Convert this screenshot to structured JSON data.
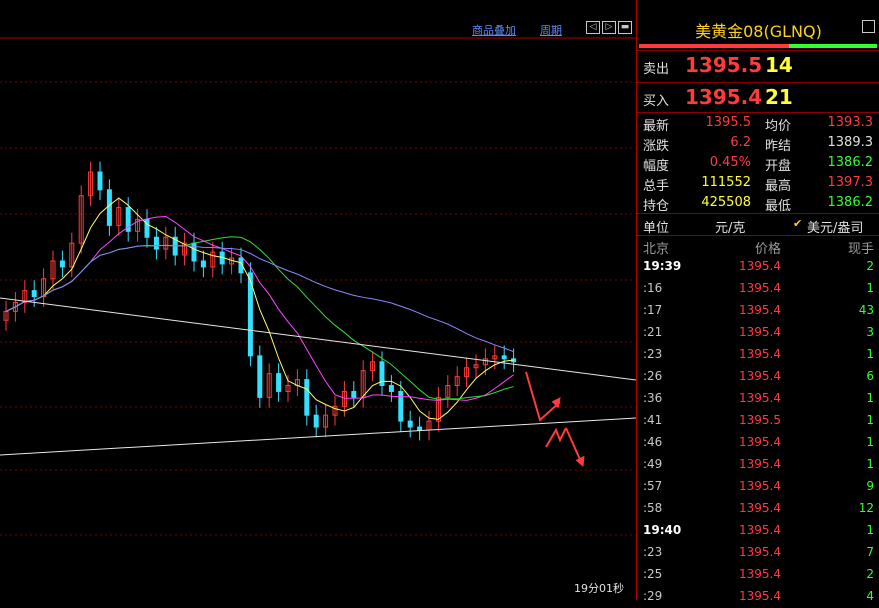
{
  "toolbar": {
    "overlay_label": "商品叠加",
    "period_label": "周期",
    "btn_left": "◁",
    "btn_right": "▷",
    "btn_max": "▬"
  },
  "chart": {
    "timer": "19分01秒",
    "candles": [
      1389.5,
      1389.8,
      1390.2,
      1390.0,
      1390.6,
      1391.2,
      1391.0,
      1391.8,
      1393.4,
      1394.2,
      1393.6,
      1392.4,
      1393.0,
      1392.2,
      1392.6,
      1392.0,
      1391.6,
      1392.0,
      1391.4,
      1391.8,
      1391.2,
      1391.0,
      1391.5,
      1391.1,
      1391.3,
      1390.8,
      1388.0,
      1386.6,
      1387.4,
      1386.8,
      1387.0,
      1387.2,
      1386.0,
      1385.6,
      1386.0,
      1386.3,
      1386.8,
      1386.6,
      1387.5,
      1387.8,
      1387.0,
      1386.8,
      1385.8,
      1385.6,
      1385.5,
      1385.8,
      1386.6,
      1387.0,
      1387.3,
      1387.6,
      1387.7,
      1387.9,
      1388.0,
      1387.9,
      1387.8
    ],
    "colors": {
      "up": "#ff3b3b",
      "down": "#33e0ff",
      "ma5": "#ffff66",
      "ma10": "#ff44ff",
      "ma20": "#33dd33",
      "ma60": "#8888ff"
    }
  },
  "panel": {
    "title": "美黄金08(GLNQ)",
    "sell_label": "卖出",
    "sell_price": "1395.5",
    "sell_vol": "14",
    "buy_label": "买入",
    "buy_price": "1395.4",
    "buy_vol": "21",
    "stats_left": [
      {
        "k": "最新",
        "v": "1395.5",
        "color": "#ff3b3b"
      },
      {
        "k": "涨跌",
        "v": "6.2",
        "color": "#ff3b3b"
      },
      {
        "k": "幅度",
        "v": "0.45%",
        "color": "#ff3b3b"
      },
      {
        "k": "总手",
        "v": "111552",
        "color": "#ffff33"
      },
      {
        "k": "持仓",
        "v": "425508",
        "color": "#ffff33"
      }
    ],
    "stats_right": [
      {
        "k": "均价",
        "v": "1393.3",
        "color": "#ff3b3b"
      },
      {
        "k": "昨结",
        "v": "1389.3",
        "color": "#e0e0e0"
      },
      {
        "k": "开盘",
        "v": "1386.2",
        "color": "#33ff33"
      },
      {
        "k": "最高",
        "v": "1397.3",
        "color": "#ff3b3b"
      },
      {
        "k": "最低",
        "v": "1386.2",
        "color": "#33ff33"
      }
    ],
    "unit_label": "单位",
    "unit_value": "元/克",
    "unit_check": "✔",
    "unit_alt": "美元/盎司",
    "tick_head": {
      "time": "北京",
      "price": "价格",
      "vol": "现手"
    },
    "ticks": [
      {
        "t": "19:39",
        "p": "1395.4",
        "q": "2",
        "bold": true
      },
      {
        "t": ":16",
        "p": "1395.4",
        "q": "1"
      },
      {
        "t": ":17",
        "p": "1395.4",
        "q": "43"
      },
      {
        "t": ":21",
        "p": "1395.4",
        "q": "3"
      },
      {
        "t": ":23",
        "p": "1395.4",
        "q": "1"
      },
      {
        "t": ":26",
        "p": "1395.4",
        "q": "6"
      },
      {
        "t": ":36",
        "p": "1395.4",
        "q": "1"
      },
      {
        "t": ":41",
        "p": "1395.5",
        "q": "1"
      },
      {
        "t": ":46",
        "p": "1395.4",
        "q": "1"
      },
      {
        "t": ":49",
        "p": "1395.4",
        "q": "1"
      },
      {
        "t": ":57",
        "p": "1395.4",
        "q": "9"
      },
      {
        "t": ":58",
        "p": "1395.4",
        "q": "12"
      },
      {
        "t": "19:40",
        "p": "1395.4",
        "q": "1",
        "bold": true
      },
      {
        "t": ":23",
        "p": "1395.4",
        "q": "7"
      },
      {
        "t": ":25",
        "p": "1395.4",
        "q": "2"
      },
      {
        "t": ":29",
        "p": "1395.4",
        "q": "4"
      }
    ]
  }
}
